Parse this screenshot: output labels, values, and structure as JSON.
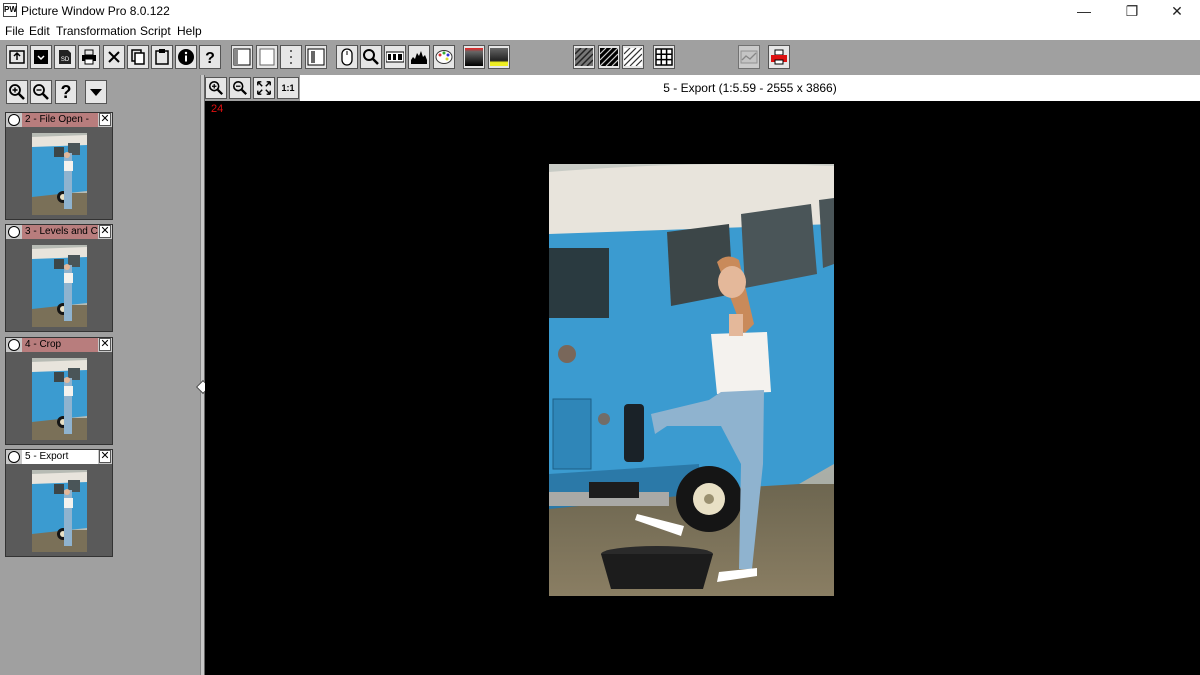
{
  "window": {
    "app_icon_text": "PW",
    "title": "Picture Window Pro 8.0.122",
    "minimize": "—",
    "restore": "❐",
    "close": "✕"
  },
  "menu": [
    "File",
    "Edit",
    "Transformation",
    "Script",
    "Help"
  ],
  "toolbar_icons": [
    "open-icon",
    "save-icon",
    "sd-card-icon",
    "print-icon",
    "close-icon",
    "copy-icon",
    "paste-icon",
    "info-icon",
    "help-icon",
    "layout-single-icon",
    "layout-full-icon",
    "layout-dots-icon",
    "layout-split-icon",
    "mouse-icon",
    "zoom-icon",
    "numeric-readout-icon",
    "histogram-icon",
    "palette-icon",
    "gradient-red-icon",
    "gradient-yellow-icon",
    "hatch-pattern-1-icon",
    "hatch-pattern-2-icon",
    "hatch-pattern-3-icon",
    "grid-icon",
    "graph-icon",
    "red-printer-icon"
  ],
  "sd_label": "SD",
  "left_panel": {
    "buttons": [
      "zoom-in-icon",
      "zoom-out-icon",
      "help-icon",
      "dropdown-icon"
    ],
    "help_glyph": "?",
    "thumbnails": [
      {
        "label": "2 - File Open -",
        "active": false
      },
      {
        "label": "3 - Levels and C",
        "active": false
      },
      {
        "label": "4 - Crop",
        "active": false
      },
      {
        "label": "5 - Export",
        "active": true
      }
    ],
    "close_glyph": "✕"
  },
  "view": {
    "zoom_buttons": [
      "zoom-in-icon",
      "zoom-out-icon",
      "fit-icon"
    ],
    "one_to_one": "1:1",
    "title": "5 - Export (1:5.59 - 2555 x 3866)",
    "readout": "24"
  },
  "colors": {
    "toolbar_bg": "#a0a0a0",
    "thumb_label_bg": "#b87d7d",
    "canvas_bg": "#000000",
    "readout_color": "#e01010",
    "van_blue": "#3b9bd0"
  }
}
